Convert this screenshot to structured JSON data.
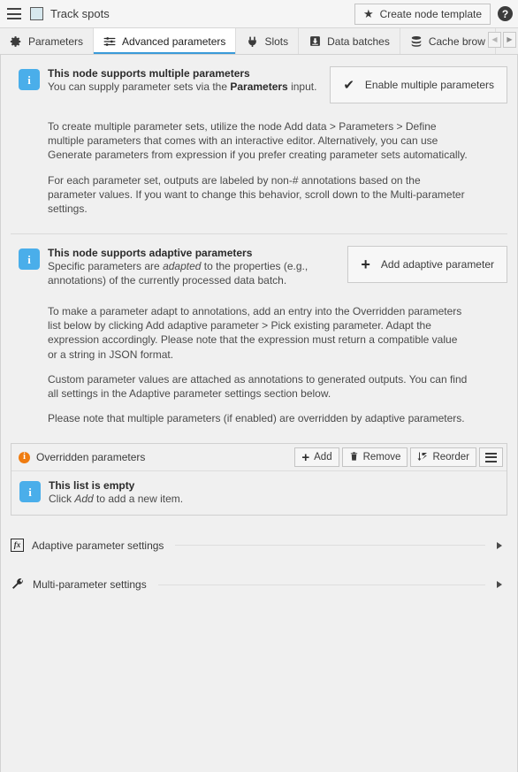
{
  "header": {
    "menu_icon": "hamburger-icon",
    "node_color_chip": "#d7e8ee",
    "node_title": "Track spots",
    "create_template_label": "Create node template",
    "star_icon": "star-icon",
    "help_icon": "help-icon",
    "help_glyph": "?"
  },
  "tabs": {
    "items": [
      {
        "label": "Parameters",
        "icon": "gear-icon",
        "active": false
      },
      {
        "label": "Advanced parameters",
        "icon": "sliders-icon",
        "active": true
      },
      {
        "label": "Slots",
        "icon": "plug-icon",
        "active": false
      },
      {
        "label": "Data batches",
        "icon": "inbox-download-icon",
        "active": false
      },
      {
        "label": "Cache brow",
        "icon": "database-icon",
        "active": false
      }
    ],
    "scroll_left_glyph": "◀",
    "scroll_right_glyph": "▶"
  },
  "multi_param_section": {
    "info_icon": "info-icon",
    "info_glyph": "i",
    "title": "This node supports multiple parameters",
    "subtitle_prefix": "You can supply parameter sets via the ",
    "subtitle_bold": "Parameters",
    "subtitle_suffix": " input.",
    "button_label": "Enable multiple parameters",
    "button_icon": "check-icon",
    "check_glyph": "✔",
    "paragraph_1": "To create multiple parameter sets, utilize the node Add data > Parameters > Define multiple parameters that comes with an interactive editor. Alternatively, you can use Generate parameters from expression if you prefer creating parameter sets automatically.",
    "paragraph_2": "For each parameter set, outputs are labeled by non-# annotations based on the parameter values. If you want to change this behavior, scroll down to the Multi-parameter settings."
  },
  "adaptive_param_section": {
    "info_icon": "info-icon",
    "info_glyph": "i",
    "title": "This node supports adaptive parameters",
    "subtitle_prefix": "Specific parameters are ",
    "subtitle_italic": "adapted",
    "subtitle_suffix": " to the properties (e.g., annotations) of the currently processed data batch.",
    "button_label": "Add adaptive parameter",
    "button_icon": "plus-icon",
    "plus_glyph": "+",
    "paragraph_1": "To make a parameter adapt to annotations, add an entry into the Overridden parameters list below by clicking Add adaptive parameter > Pick existing parameter. Adapt the expression accordingly. Please note that the expression must return a compatible value or a string in JSON format.",
    "paragraph_2": "Custom parameter values are attached as annotations to generated outputs. You can find all settings in the Adaptive parameter settings section below.",
    "paragraph_3": "Please note that multiple parameters (if enabled) are overridden by adaptive parameters."
  },
  "overridden_panel": {
    "status_icon": "orange-info-icon",
    "status_glyph": "i",
    "title": "Overridden parameters",
    "buttons": [
      {
        "label": "Add",
        "icon": "plus-icon",
        "glyph": "+"
      },
      {
        "label": "Remove",
        "icon": "trash-icon",
        "glyph": ""
      },
      {
        "label": "Reorder",
        "icon": "sort-icon",
        "glyph": ""
      }
    ],
    "menu_button_icon": "hamburger-menu-icon",
    "empty_state": {
      "icon": "info-icon",
      "glyph": "i",
      "title": "This list is empty",
      "text_prefix": "Click ",
      "text_italic": "Add",
      "text_suffix": " to add a new item."
    }
  },
  "collapsible_sections": [
    {
      "label": "Adaptive parameter settings",
      "icon": "fx-icon",
      "glyph": "fx",
      "arrow": "chevron-right-icon"
    },
    {
      "label": "Multi-parameter settings",
      "icon": "wrench-icon",
      "glyph": "",
      "arrow": "chevron-right-icon"
    }
  ],
  "colors": {
    "accent_blue": "#3a9ad9",
    "info_blue": "#4aaeea",
    "warn_orange": "#ef7c10",
    "panel_bg": "#f0f0f0",
    "header_bg": "#f5f5f5"
  }
}
